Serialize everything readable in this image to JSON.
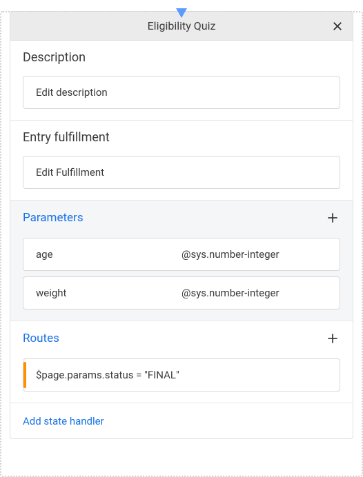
{
  "header": {
    "title": "Eligibility Quiz"
  },
  "description": {
    "label": "Description",
    "edit_label": "Edit description"
  },
  "entry_fulfillment": {
    "label": "Entry fulfillment",
    "edit_label": "Edit Fulfillment"
  },
  "parameters": {
    "label": "Parameters",
    "items": [
      {
        "name": "age",
        "type": "@sys.number-integer"
      },
      {
        "name": "weight",
        "type": "@sys.number-integer"
      }
    ]
  },
  "routes": {
    "label": "Routes",
    "items": [
      {
        "condition": "$page.params.status = \"FINAL\""
      }
    ]
  },
  "state_handler": {
    "label": "Add state handler"
  }
}
